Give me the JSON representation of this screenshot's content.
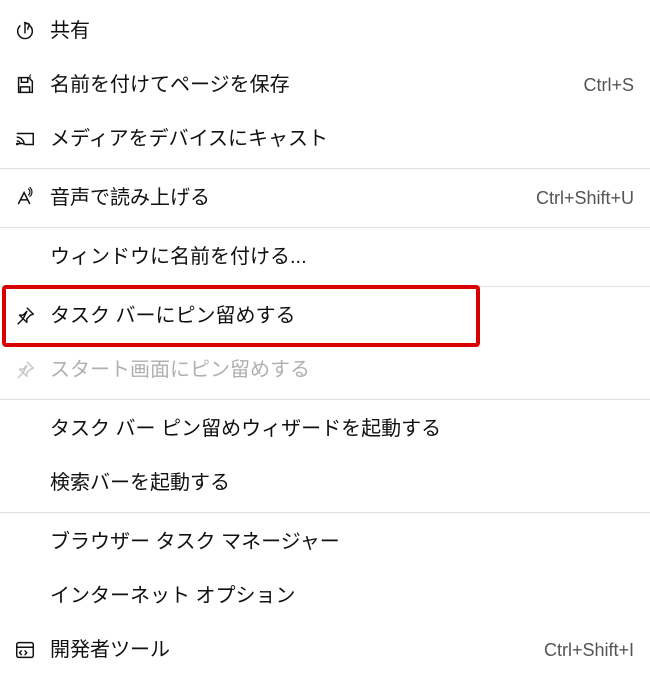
{
  "menu": {
    "share": {
      "label": "共有",
      "shortcut": ""
    },
    "save_page": {
      "label": "名前を付けてページを保存",
      "shortcut": "Ctrl+S"
    },
    "cast": {
      "label": "メディアをデバイスにキャスト",
      "shortcut": ""
    },
    "read_aloud": {
      "label": "音声で読み上げる",
      "shortcut": "Ctrl+Shift+U"
    },
    "name_window": {
      "label": "ウィンドウに名前を付ける...",
      "shortcut": ""
    },
    "pin_taskbar": {
      "label": "タスク バーにピン留めする",
      "shortcut": ""
    },
    "pin_start": {
      "label": "スタート画面にピン留めする",
      "shortcut": ""
    },
    "launch_pin_wizard": {
      "label": "タスク バー ピン留めウィザードを起動する",
      "shortcut": ""
    },
    "launch_searchbar": {
      "label": "検索バーを起動する",
      "shortcut": ""
    },
    "task_manager": {
      "label": "ブラウザー タスク マネージャー",
      "shortcut": ""
    },
    "internet_options": {
      "label": "インターネット オプション",
      "shortcut": ""
    },
    "dev_tools": {
      "label": "開発者ツール",
      "shortcut": "Ctrl+Shift+I"
    }
  }
}
